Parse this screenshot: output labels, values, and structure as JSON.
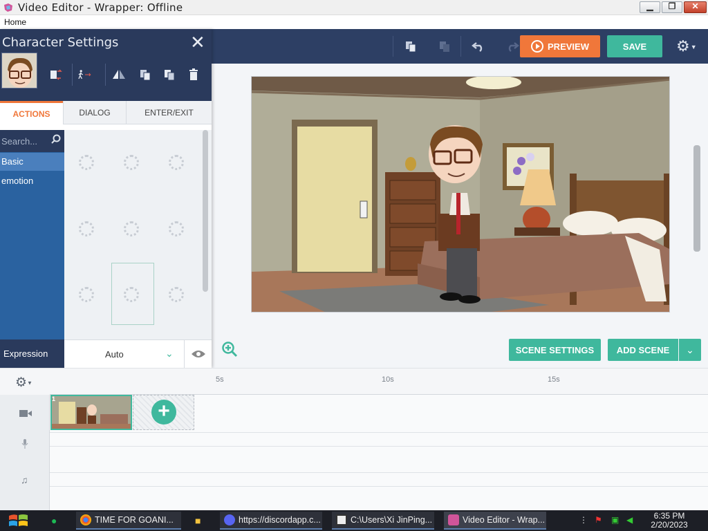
{
  "window": {
    "title": "Video Editor - Wrapper: Offline",
    "minimize_glyph": "▁",
    "maximize_glyph": "❐",
    "close_glyph": "✕"
  },
  "menu": {
    "home": "Home"
  },
  "header": {
    "preview_label": "PREVIEW",
    "save_label": "SAVE",
    "icons": [
      "copy-icon",
      "paste-icon",
      "undo-icon",
      "redo-icon",
      "gear-icon"
    ]
  },
  "character_panel": {
    "title": "Character Settings",
    "close_glyph": "✕",
    "tools": [
      "swap-character-icon",
      "walk-icon",
      "flip-icon",
      "copy-icon",
      "paste-icon",
      "delete-icon"
    ],
    "tabs": [
      "ACTIONS",
      "DIALOG",
      "ENTER/EXIT"
    ],
    "active_tab": "ACTIONS",
    "search_placeholder": "Search...",
    "categories": [
      "Basic",
      "emotion"
    ],
    "active_category": "Basic",
    "expression_label": "Expression",
    "expression_value": "Auto"
  },
  "stage": {
    "scene_settings_label": "SCENE SETTINGS",
    "add_scene_label": "ADD SCENE"
  },
  "timeline": {
    "tick_labels": [
      "5s",
      "10s",
      "15s"
    ],
    "scene_number": "1",
    "track_icons": [
      "camera-icon",
      "microphone-icon",
      "music-icon"
    ]
  },
  "taskbar": {
    "tasks": [
      {
        "label": "TIME FOR GOANI...",
        "icon": "chrome-icon"
      },
      {
        "label": "https://discordapp.c...",
        "icon": "discord-icon"
      },
      {
        "label": "C:\\Users\\Xi JinPing...",
        "icon": "7zip-icon"
      },
      {
        "label": "Video Editor - Wrap...",
        "icon": "wrapper-icon"
      }
    ],
    "time": "6:35 PM",
    "date": "2/20/2023"
  },
  "colors": {
    "header_bg": "#2d3f64",
    "accent_green": "#3fb89d",
    "accent_orange": "#f0773a",
    "sidebar_blue": "#2a62a0"
  }
}
